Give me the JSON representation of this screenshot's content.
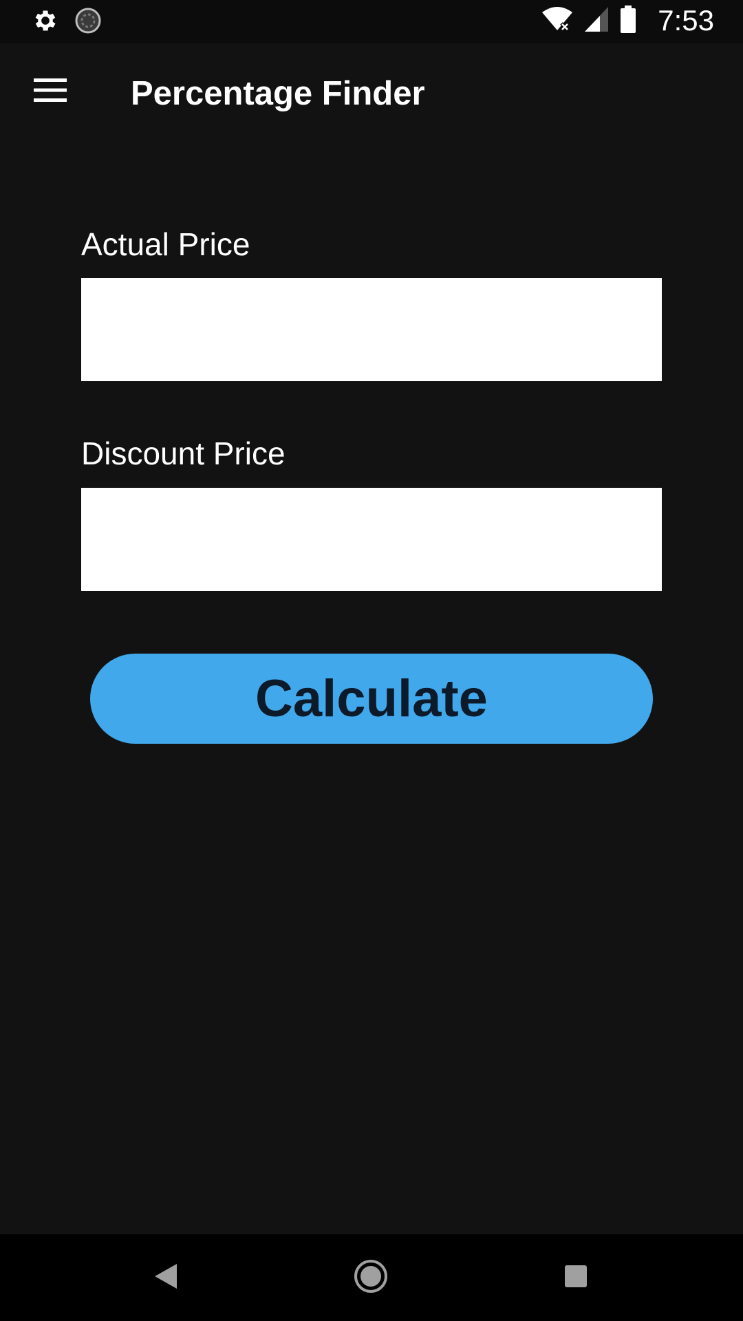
{
  "status_bar": {
    "time": "7:53",
    "icons": [
      "settings-icon",
      "sync-icon",
      "wifi-off-icon",
      "signal-icon",
      "battery-icon"
    ]
  },
  "app_bar": {
    "title": "Percentage Finder",
    "menu_icon": "hamburger-menu-icon"
  },
  "form": {
    "actual_price": {
      "label": "Actual Price",
      "value": "",
      "placeholder": ""
    },
    "discount_price": {
      "label": "Discount Price",
      "value": "",
      "placeholder": ""
    },
    "calculate_label": "Calculate"
  },
  "nav_bar": {
    "icons": [
      "back-icon",
      "home-icon",
      "recents-icon"
    ]
  },
  "colors": {
    "background": "#121212",
    "accent": "#42a8ec",
    "button_text": "#0c1a2a",
    "input_background": "#ffffff"
  }
}
